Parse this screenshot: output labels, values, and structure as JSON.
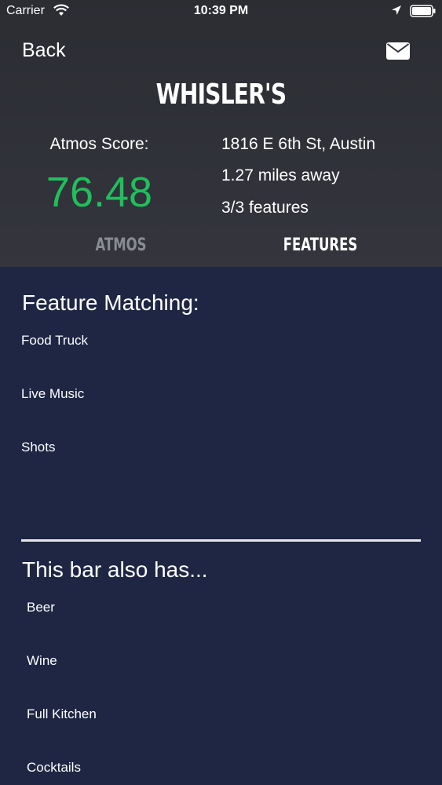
{
  "status": {
    "carrier": "Carrier",
    "time": "10:39 PM"
  },
  "nav": {
    "back_label": "Back"
  },
  "bar": {
    "name": "WHISLER'S",
    "score_label": "Atmos Score:",
    "score_value": "76.48",
    "address": "1816 E 6th St, Austin",
    "distance": "1.27 miles away",
    "features_count": "3/3 features"
  },
  "tabs": {
    "atmos": "ATMOS",
    "features": "FEATURES"
  },
  "matching": {
    "title": "Feature Matching:",
    "items": [
      "Food Truck",
      "Live Music",
      "Shots"
    ]
  },
  "also_has": {
    "title": "This bar also has...",
    "items": [
      "Beer",
      "Wine",
      "Full Kitchen",
      "Cocktails"
    ]
  },
  "colors": {
    "header_bg": "#2b2d33",
    "page_bg": "#1e2644",
    "score_green": "#1fc05a",
    "inactive_tab": "#8a8c93"
  }
}
